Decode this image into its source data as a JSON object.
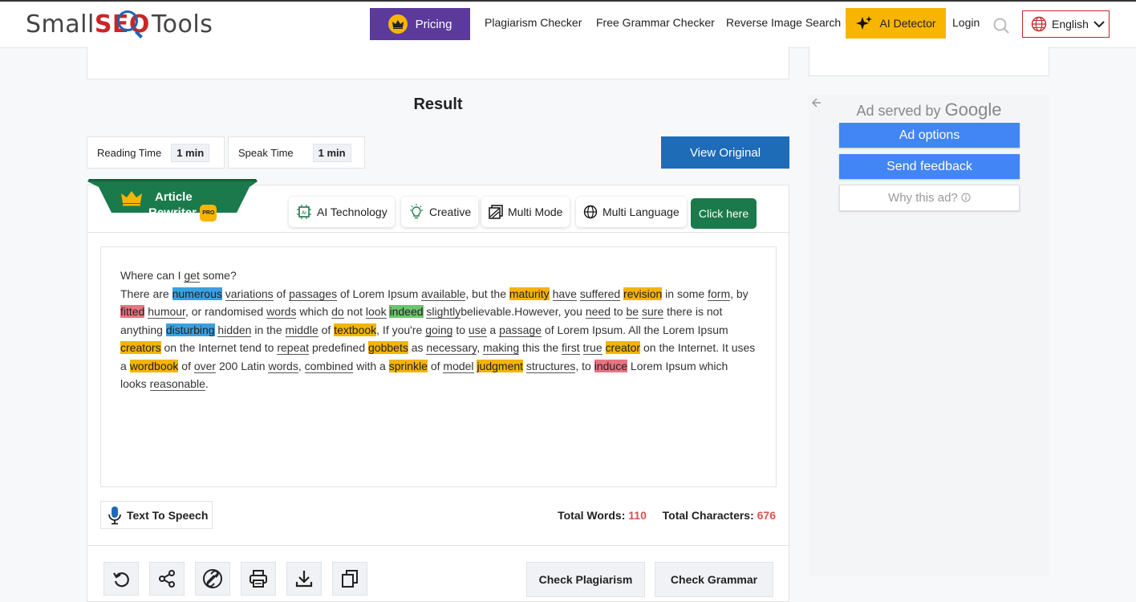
{
  "header": {
    "logo": {
      "part1": "Small",
      "part2": "SEO",
      "part3": "Tools"
    },
    "pricing_label": "Pricing",
    "nav": [
      "Plagiarism Checker",
      "Free Grammar Checker",
      "Reverse Image Search"
    ],
    "ai_detector_label": "AI Detector",
    "login_label": "Login",
    "language_label": "English",
    "colors": {
      "pricing_bg": "#5b3a9c",
      "ai_bg": "#f7b500",
      "accent_red": "#c62828"
    }
  },
  "main": {
    "result_title": "Result",
    "reading_time_label": "Reading Time",
    "reading_time_value": "1 min",
    "speak_time_label": "Speak Time",
    "speak_time_value": "1 min",
    "view_original_label": "View Original",
    "ribbon": {
      "line1": "Article",
      "line2": "Rewriter",
      "badge": "PRO"
    },
    "features": [
      "AI Technology",
      "Creative",
      "Multi Mode",
      "Multi Language"
    ],
    "click_here_label": "Click here",
    "text_lines": {
      "l1": [
        "Where can I ",
        "get",
        " some?"
      ],
      "seg": [
        "There are ",
        "numerous",
        " ",
        "variations",
        " of ",
        "passages",
        " of Lorem Ipsum ",
        "available",
        ", but the ",
        "maturity",
        " ",
        "have",
        " ",
        "suffered",
        " ",
        "revision",
        " in some ",
        "form",
        ", by ",
        "fitted",
        " ",
        "humour",
        ", or randomised ",
        "words",
        " which ",
        "do",
        " not ",
        "look",
        " ",
        "indeed",
        " ",
        "slightly",
        "believable.However, you ",
        "need",
        " to ",
        "be",
        " ",
        "sure",
        " there is not ",
        "anything ",
        "disturbing",
        " ",
        "hidden",
        " in the ",
        "middle",
        " of ",
        "textbook",
        ", If you're ",
        "going",
        " to ",
        "use",
        " a ",
        "passage",
        " of Lorem Ipsum. All the Lorem Ipsum ",
        "creators",
        " on the Internet tend to ",
        "repeat",
        " predefined ",
        "gobbets",
        " as ",
        "necessary",
        ", ",
        "making",
        " this the ",
        "first",
        " ",
        "true",
        " ",
        "creator",
        " on the Internet. It ",
        "uses a ",
        "wordbook",
        " of ",
        "over",
        " 200 Latin ",
        "words",
        ", ",
        "combined",
        " with a ",
        "sprinkle",
        " of ",
        "model",
        " ",
        "judgment",
        " ",
        "structures",
        ", to ",
        "induce",
        " Lorem Ipsum ",
        "which looks ",
        "reasonable",
        "."
      ]
    },
    "tts_label": "Text To Speech",
    "total_words_label": "Total Words:",
    "total_words_value": "110",
    "total_chars_label": "Total Characters:",
    "total_chars_value": "676",
    "tools": [
      "refresh-icon",
      "share-icon",
      "unlink-icon",
      "print-icon",
      "download-icon",
      "copy-icon"
    ],
    "check_plagiarism_label": "Check Plagiarism",
    "check_grammar_label": "Check Grammar",
    "highlight_colors": {
      "blue": "#3aa0e0",
      "orange": "#f4b400",
      "red": "#e87480",
      "green": "#6cc56b"
    }
  },
  "ad": {
    "served_by": "Ad served by",
    "google": "Google",
    "ad_options": "Ad options",
    "send_feedback": "Send feedback",
    "why_this_ad": "Why this ad?"
  }
}
